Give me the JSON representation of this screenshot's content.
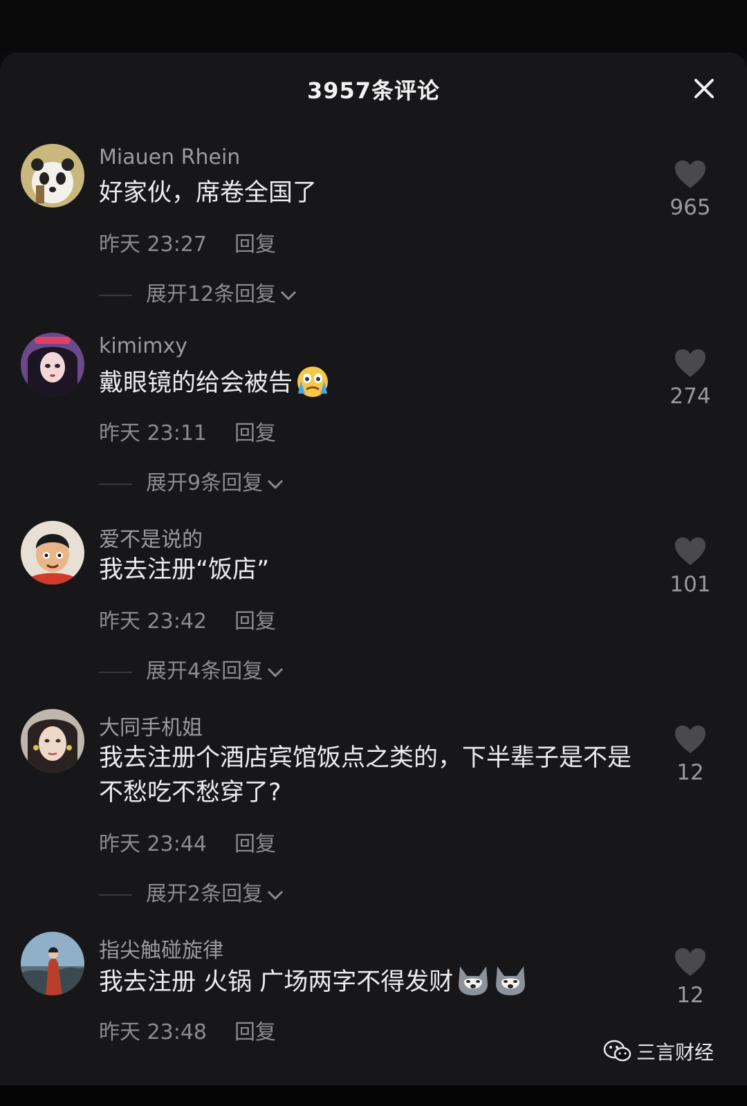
{
  "header": {
    "title": "3957条评论"
  },
  "comments": [
    {
      "username": "Miauen Rhein",
      "text": "好家伙，席卷全国了",
      "time": "昨天 23:27",
      "reply": "回复",
      "expand": "展开12条回复",
      "likes": "965"
    },
    {
      "username": "kimimxy",
      "text": "戴眼镜的给会被告",
      "time": "昨天 23:11",
      "reply": "回复",
      "expand": "展开9条回复",
      "likes": "274"
    },
    {
      "username": "爱不是说的",
      "text": "我去注册“饭店”",
      "time": "昨天 23:42",
      "reply": "回复",
      "expand": "展开4条回复",
      "likes": "101"
    },
    {
      "username": "大同手机姐",
      "text": "我去注册个酒店宾馆饭点之类的，下半辈子是不是不愁吃不愁穿了?",
      "time": "昨天 23:44",
      "reply": "回复",
      "expand": "展开2条回复",
      "likes": "12"
    },
    {
      "username": "指尖触碰旋律",
      "text": "我去注册 火锅 广场两字不得发财",
      "time": "昨天 23:48",
      "reply": "回复",
      "likes": "12"
    }
  ],
  "watermark": {
    "label": "三言财经"
  },
  "icons": {
    "close": "close-icon",
    "like": "heart-icon",
    "expand": "chevron-down-icon",
    "emoji_cry": "crying-face-emoji",
    "emoji_dog": "husky-emoji",
    "watermark": "wechat-icon"
  },
  "colors": {
    "background": "#171719",
    "text": "#ececee",
    "secondary": "#8c8c90"
  }
}
